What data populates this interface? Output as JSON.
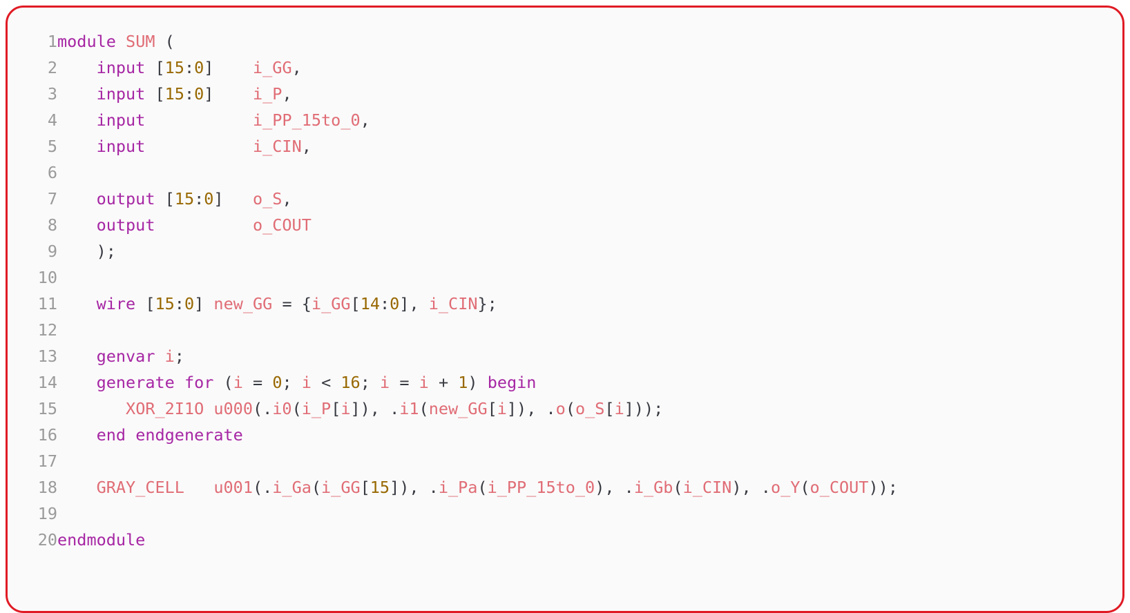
{
  "editor": {
    "language": "verilog",
    "border_color": "#e01b24",
    "background_color": "#fafafa",
    "colors": {
      "keyword": "#a626a4",
      "identifier": "#e06c75",
      "number": "#986801",
      "punctuation": "#383a42",
      "line_number": "#9a9a9a"
    },
    "first_line_number": 1,
    "last_line_number": 20
  },
  "code": {
    "lines": [
      {
        "number": "1",
        "text": "module SUM (",
        "tokens": [
          {
            "t": "module",
            "c": "kw"
          },
          {
            "t": " ",
            "c": "plain"
          },
          {
            "t": "SUM",
            "c": "id"
          },
          {
            "t": " ",
            "c": "plain"
          },
          {
            "t": "(",
            "c": "pun"
          }
        ]
      },
      {
        "number": "2",
        "text": "    input [15:0]    i_GG,",
        "tokens": [
          {
            "t": "    ",
            "c": "plain"
          },
          {
            "t": "input",
            "c": "kw"
          },
          {
            "t": " ",
            "c": "plain"
          },
          {
            "t": "[",
            "c": "pun"
          },
          {
            "t": "15",
            "c": "num"
          },
          {
            "t": ":",
            "c": "pun"
          },
          {
            "t": "0",
            "c": "num"
          },
          {
            "t": "]",
            "c": "pun"
          },
          {
            "t": "    ",
            "c": "plain"
          },
          {
            "t": "i_GG",
            "c": "id"
          },
          {
            "t": ",",
            "c": "pun"
          }
        ]
      },
      {
        "number": "3",
        "text": "    input [15:0]    i_P,",
        "tokens": [
          {
            "t": "    ",
            "c": "plain"
          },
          {
            "t": "input",
            "c": "kw"
          },
          {
            "t": " ",
            "c": "plain"
          },
          {
            "t": "[",
            "c": "pun"
          },
          {
            "t": "15",
            "c": "num"
          },
          {
            "t": ":",
            "c": "pun"
          },
          {
            "t": "0",
            "c": "num"
          },
          {
            "t": "]",
            "c": "pun"
          },
          {
            "t": "    ",
            "c": "plain"
          },
          {
            "t": "i_P",
            "c": "id"
          },
          {
            "t": ",",
            "c": "pun"
          }
        ]
      },
      {
        "number": "4",
        "text": "    input           i_PP_15to_0,",
        "tokens": [
          {
            "t": "    ",
            "c": "plain"
          },
          {
            "t": "input",
            "c": "kw"
          },
          {
            "t": "           ",
            "c": "plain"
          },
          {
            "t": "i_PP_15to_0",
            "c": "id"
          },
          {
            "t": ",",
            "c": "pun"
          }
        ]
      },
      {
        "number": "5",
        "text": "    input           i_CIN,",
        "tokens": [
          {
            "t": "    ",
            "c": "plain"
          },
          {
            "t": "input",
            "c": "kw"
          },
          {
            "t": "           ",
            "c": "plain"
          },
          {
            "t": "i_CIN",
            "c": "id"
          },
          {
            "t": ",",
            "c": "pun"
          }
        ]
      },
      {
        "number": "6",
        "text": "",
        "tokens": []
      },
      {
        "number": "7",
        "text": "    output [15:0]   o_S,",
        "tokens": [
          {
            "t": "    ",
            "c": "plain"
          },
          {
            "t": "output",
            "c": "kw"
          },
          {
            "t": " ",
            "c": "plain"
          },
          {
            "t": "[",
            "c": "pun"
          },
          {
            "t": "15",
            "c": "num"
          },
          {
            "t": ":",
            "c": "pun"
          },
          {
            "t": "0",
            "c": "num"
          },
          {
            "t": "]",
            "c": "pun"
          },
          {
            "t": "   ",
            "c": "plain"
          },
          {
            "t": "o_S",
            "c": "id"
          },
          {
            "t": ",",
            "c": "pun"
          }
        ]
      },
      {
        "number": "8",
        "text": "    output          o_COUT",
        "tokens": [
          {
            "t": "    ",
            "c": "plain"
          },
          {
            "t": "output",
            "c": "kw"
          },
          {
            "t": "          ",
            "c": "plain"
          },
          {
            "t": "o_COUT",
            "c": "id"
          }
        ]
      },
      {
        "number": "9",
        "text": "    );",
        "tokens": [
          {
            "t": "    ",
            "c": "plain"
          },
          {
            "t": ");",
            "c": "pun"
          }
        ]
      },
      {
        "number": "10",
        "text": "",
        "tokens": []
      },
      {
        "number": "11",
        "text": "    wire [15:0] new_GG = {i_GG[14:0], i_CIN};",
        "tokens": [
          {
            "t": "    ",
            "c": "plain"
          },
          {
            "t": "wire",
            "c": "kw"
          },
          {
            "t": " ",
            "c": "plain"
          },
          {
            "t": "[",
            "c": "pun"
          },
          {
            "t": "15",
            "c": "num"
          },
          {
            "t": ":",
            "c": "pun"
          },
          {
            "t": "0",
            "c": "num"
          },
          {
            "t": "]",
            "c": "pun"
          },
          {
            "t": " ",
            "c": "plain"
          },
          {
            "t": "new_GG",
            "c": "id"
          },
          {
            "t": " ",
            "c": "plain"
          },
          {
            "t": "=",
            "c": "pun"
          },
          {
            "t": " ",
            "c": "plain"
          },
          {
            "t": "{",
            "c": "pun"
          },
          {
            "t": "i_GG",
            "c": "id"
          },
          {
            "t": "[",
            "c": "pun"
          },
          {
            "t": "14",
            "c": "num"
          },
          {
            "t": ":",
            "c": "pun"
          },
          {
            "t": "0",
            "c": "num"
          },
          {
            "t": "]",
            "c": "pun"
          },
          {
            "t": ", ",
            "c": "pun"
          },
          {
            "t": "i_CIN",
            "c": "id"
          },
          {
            "t": "};",
            "c": "pun"
          }
        ]
      },
      {
        "number": "12",
        "text": "",
        "tokens": []
      },
      {
        "number": "13",
        "text": "    genvar i;",
        "tokens": [
          {
            "t": "    ",
            "c": "plain"
          },
          {
            "t": "genvar",
            "c": "kw"
          },
          {
            "t": " ",
            "c": "plain"
          },
          {
            "t": "i",
            "c": "id"
          },
          {
            "t": ";",
            "c": "pun"
          }
        ]
      },
      {
        "number": "14",
        "text": "    generate for (i = 0; i < 16; i = i + 1) begin",
        "tokens": [
          {
            "t": "    ",
            "c": "plain"
          },
          {
            "t": "generate",
            "c": "kw"
          },
          {
            "t": " ",
            "c": "plain"
          },
          {
            "t": "for",
            "c": "kw"
          },
          {
            "t": " ",
            "c": "plain"
          },
          {
            "t": "(",
            "c": "pun"
          },
          {
            "t": "i",
            "c": "id"
          },
          {
            "t": " ",
            "c": "plain"
          },
          {
            "t": "=",
            "c": "pun"
          },
          {
            "t": " ",
            "c": "plain"
          },
          {
            "t": "0",
            "c": "num"
          },
          {
            "t": "; ",
            "c": "pun"
          },
          {
            "t": "i",
            "c": "id"
          },
          {
            "t": " ",
            "c": "plain"
          },
          {
            "t": "<",
            "c": "pun"
          },
          {
            "t": " ",
            "c": "plain"
          },
          {
            "t": "16",
            "c": "num"
          },
          {
            "t": "; ",
            "c": "pun"
          },
          {
            "t": "i",
            "c": "id"
          },
          {
            "t": " ",
            "c": "plain"
          },
          {
            "t": "=",
            "c": "pun"
          },
          {
            "t": " ",
            "c": "plain"
          },
          {
            "t": "i",
            "c": "id"
          },
          {
            "t": " ",
            "c": "plain"
          },
          {
            "t": "+",
            "c": "pun"
          },
          {
            "t": " ",
            "c": "plain"
          },
          {
            "t": "1",
            "c": "num"
          },
          {
            "t": ")",
            "c": "pun"
          },
          {
            "t": " ",
            "c": "plain"
          },
          {
            "t": "begin",
            "c": "kw"
          }
        ]
      },
      {
        "number": "15",
        "text": "       XOR_2I1O u000(.i0(i_P[i]), .i1(new_GG[i]), .o(o_S[i]));",
        "tokens": [
          {
            "t": "       ",
            "c": "plain"
          },
          {
            "t": "XOR_2I1O",
            "c": "id"
          },
          {
            "t": " ",
            "c": "plain"
          },
          {
            "t": "u000",
            "c": "id"
          },
          {
            "t": "(.",
            "c": "pun"
          },
          {
            "t": "i0",
            "c": "id"
          },
          {
            "t": "(",
            "c": "pun"
          },
          {
            "t": "i_P",
            "c": "id"
          },
          {
            "t": "[",
            "c": "pun"
          },
          {
            "t": "i",
            "c": "id"
          },
          {
            "t": "])",
            "c": "pun"
          },
          {
            "t": ", .",
            "c": "pun"
          },
          {
            "t": "i1",
            "c": "id"
          },
          {
            "t": "(",
            "c": "pun"
          },
          {
            "t": "new_GG",
            "c": "id"
          },
          {
            "t": "[",
            "c": "pun"
          },
          {
            "t": "i",
            "c": "id"
          },
          {
            "t": "])",
            "c": "pun"
          },
          {
            "t": ", .",
            "c": "pun"
          },
          {
            "t": "o",
            "c": "id"
          },
          {
            "t": "(",
            "c": "pun"
          },
          {
            "t": "o_S",
            "c": "id"
          },
          {
            "t": "[",
            "c": "pun"
          },
          {
            "t": "i",
            "c": "id"
          },
          {
            "t": "]));",
            "c": "pun"
          }
        ]
      },
      {
        "number": "16",
        "text": "    end endgenerate",
        "tokens": [
          {
            "t": "    ",
            "c": "plain"
          },
          {
            "t": "end",
            "c": "kw"
          },
          {
            "t": " ",
            "c": "plain"
          },
          {
            "t": "endgenerate",
            "c": "kw"
          }
        ]
      },
      {
        "number": "17",
        "text": "",
        "tokens": []
      },
      {
        "number": "18",
        "text": "    GRAY_CELL   u001(.i_Ga(i_GG[15]), .i_Pa(i_PP_15to_0), .i_Gb(i_CIN), .o_Y(o_COUT));",
        "tokens": [
          {
            "t": "    ",
            "c": "plain"
          },
          {
            "t": "GRAY_CELL",
            "c": "id"
          },
          {
            "t": "   ",
            "c": "plain"
          },
          {
            "t": "u001",
            "c": "id"
          },
          {
            "t": "(.",
            "c": "pun"
          },
          {
            "t": "i_Ga",
            "c": "id"
          },
          {
            "t": "(",
            "c": "pun"
          },
          {
            "t": "i_GG",
            "c": "id"
          },
          {
            "t": "[",
            "c": "pun"
          },
          {
            "t": "15",
            "c": "num"
          },
          {
            "t": "])",
            "c": "pun"
          },
          {
            "t": ", .",
            "c": "pun"
          },
          {
            "t": "i_Pa",
            "c": "id"
          },
          {
            "t": "(",
            "c": "pun"
          },
          {
            "t": "i_PP_15to_0",
            "c": "id"
          },
          {
            "t": ")",
            "c": "pun"
          },
          {
            "t": ", .",
            "c": "pun"
          },
          {
            "t": "i_Gb",
            "c": "id"
          },
          {
            "t": "(",
            "c": "pun"
          },
          {
            "t": "i_CIN",
            "c": "id"
          },
          {
            "t": ")",
            "c": "pun"
          },
          {
            "t": ", .",
            "c": "pun"
          },
          {
            "t": "o_Y",
            "c": "id"
          },
          {
            "t": "(",
            "c": "pun"
          },
          {
            "t": "o_COUT",
            "c": "id"
          },
          {
            "t": "));",
            "c": "pun"
          }
        ]
      },
      {
        "number": "19",
        "text": "",
        "tokens": []
      },
      {
        "number": "20",
        "text": "endmodule",
        "tokens": [
          {
            "t": "endmodule",
            "c": "kw"
          }
        ]
      }
    ]
  }
}
